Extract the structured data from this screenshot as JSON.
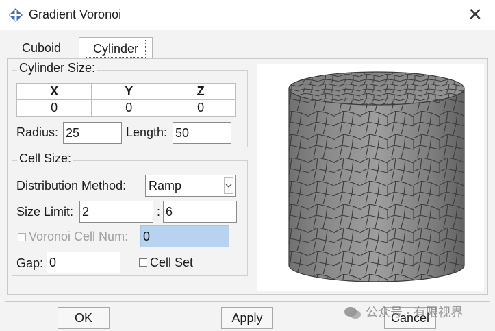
{
  "window": {
    "title": "Gradient Voronoi",
    "close_glyph": "✕",
    "icon": "app-icon"
  },
  "tabs": [
    {
      "label": "Cuboid",
      "selected": false
    },
    {
      "label": "Cylinder",
      "selected": true
    }
  ],
  "cylinder_size": {
    "title": "Cylinder Size:",
    "headers": [
      "X",
      "Y",
      "Z"
    ],
    "values": [
      "0",
      "0",
      "0"
    ],
    "radius_label": "Radius:",
    "radius_value": "25",
    "length_label": "Length:",
    "length_value": "50"
  },
  "cell_size": {
    "title": "Cell Size:",
    "distribution_label": "Distribution Method:",
    "distribution_value": "Ramp",
    "size_limit_label": "Size Limit:",
    "size_limit_min": "2",
    "size_limit_sep": ":",
    "size_limit_max": "6",
    "voronoi_cell_num_label": "Voronoi Cell Num:",
    "voronoi_cell_num_value": "0",
    "voronoi_cell_num_checked": false,
    "gap_label": "Gap:",
    "gap_value": "0",
    "cell_set_label": "Cell Set",
    "cell_set_checked": false
  },
  "preview": {
    "description_icon": "voronoi-cylinder-preview"
  },
  "buttons": {
    "ok": "OK",
    "apply": "Apply",
    "cancel": "Cancel"
  },
  "watermark": {
    "text": "公众号 · 有限视界",
    "icon": "wechat-icon"
  },
  "colors": {
    "highlight_field": "#b7d3ef",
    "app_icon": "#3f6fb5",
    "mesh_fill": "#8a8a8a"
  }
}
